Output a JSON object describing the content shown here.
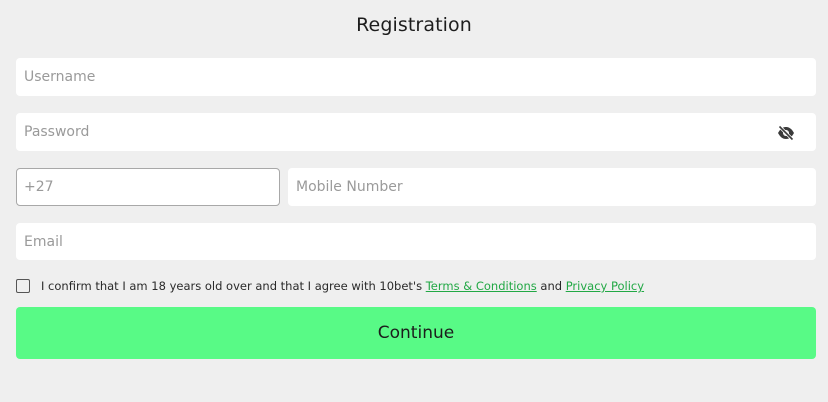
{
  "form": {
    "title": "Registration",
    "username": {
      "placeholder": "Username",
      "value": ""
    },
    "password": {
      "placeholder": "Password",
      "value": "",
      "toggle_icon": "eye-slash-icon"
    },
    "phone_code": {
      "value": "+27"
    },
    "mobile": {
      "placeholder": "Mobile Number",
      "value": ""
    },
    "email": {
      "placeholder": "Email",
      "value": ""
    },
    "consent": {
      "checked": false,
      "text_before": "I confirm that I am 18 years old over and that I agree with 10bet's",
      "terms_link": "Terms & Conditions",
      "and": "and",
      "privacy_link": "Privacy Policy"
    },
    "submit_label": "Continue"
  },
  "colors": {
    "background": "#efefef",
    "button": "#58fa86",
    "link": "#22a845"
  }
}
